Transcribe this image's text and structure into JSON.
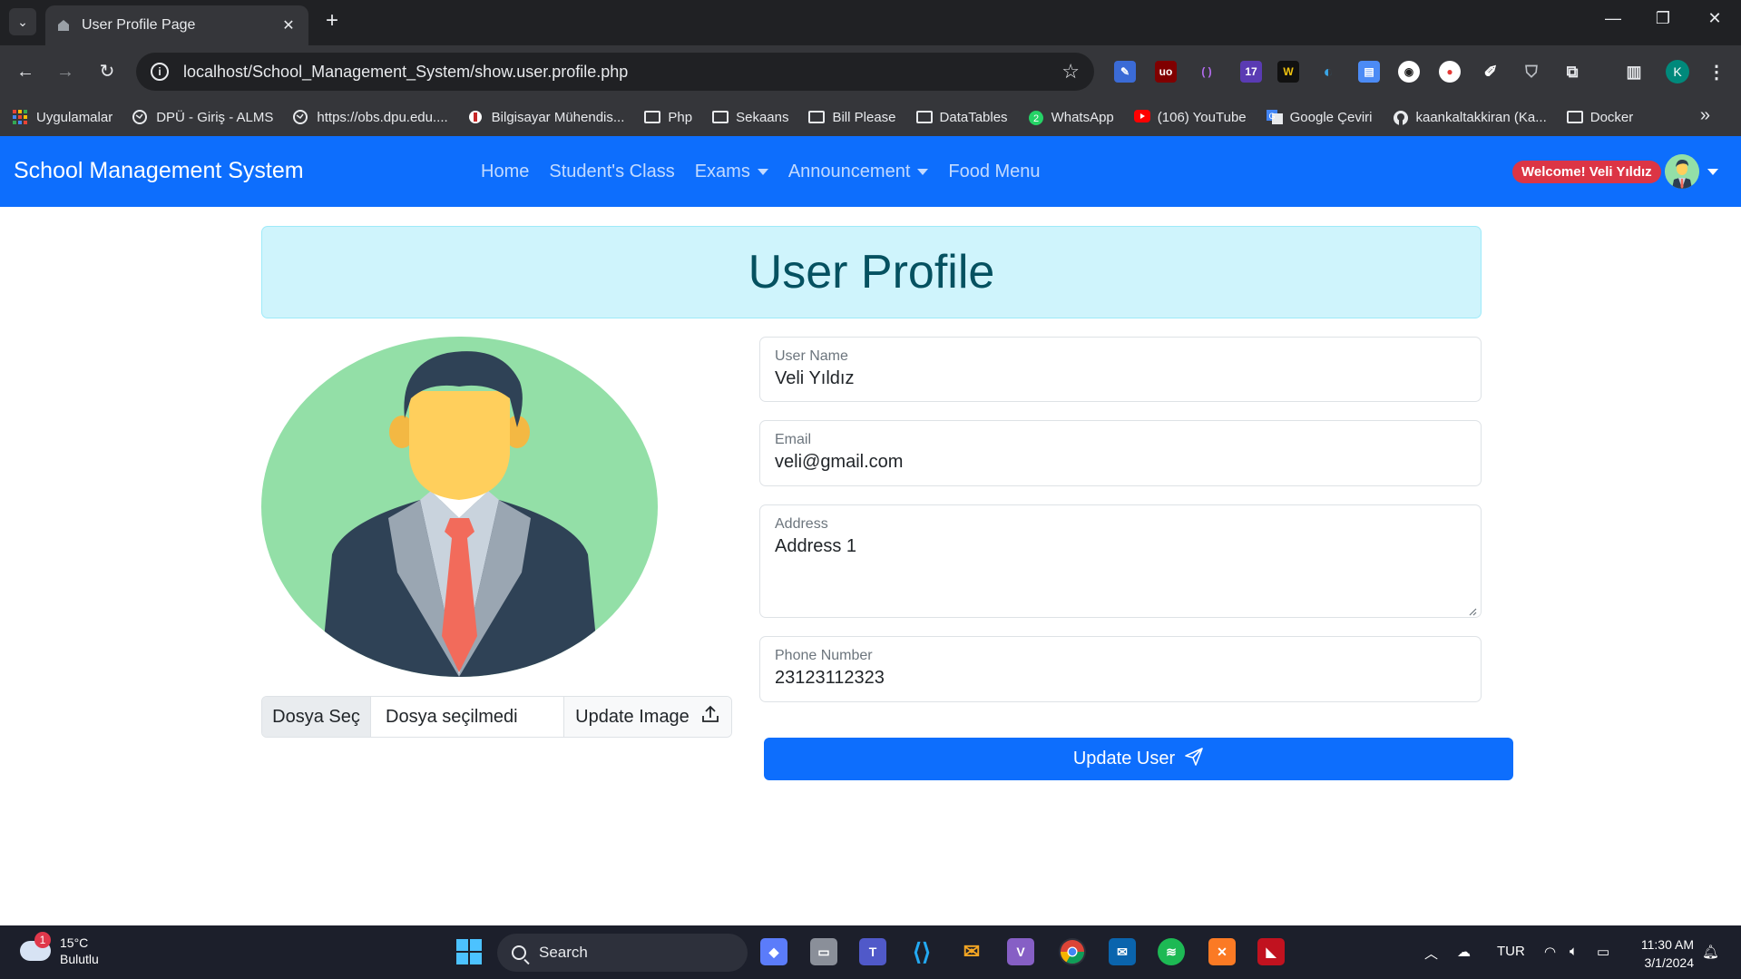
{
  "browser": {
    "tab_title": "User Profile Page",
    "url": "localhost/School_Management_System/show.user.profile.php",
    "bookmarks": [
      {
        "label": "Uygulamalar",
        "icon": "apps-grid-icon"
      },
      {
        "label": "DPÜ - Giriş - ALMS",
        "icon": "globe-icon"
      },
      {
        "label": "https://obs.dpu.edu....",
        "icon": "globe-icon"
      },
      {
        "label": "Bilgisayar Mühendis...",
        "icon": "university-icon"
      },
      {
        "label": "Php",
        "icon": "folder-icon"
      },
      {
        "label": "Sekaans",
        "icon": "folder-icon"
      },
      {
        "label": "Bill Please",
        "icon": "folder-icon"
      },
      {
        "label": "DataTables",
        "icon": "folder-icon"
      },
      {
        "label": "WhatsApp",
        "icon": "whatsapp-icon"
      },
      {
        "label": "(106) YouTube",
        "icon": "youtube-icon"
      },
      {
        "label": "Google Çeviri",
        "icon": "google-translate-icon"
      },
      {
        "label": "kaankaltakkiran (Ka...",
        "icon": "github-icon"
      },
      {
        "label": "Docker",
        "icon": "folder-icon"
      }
    ],
    "extension_badge": "17",
    "profile_initial": "K"
  },
  "navbar": {
    "brand": "School Management System",
    "links": [
      {
        "label": "Home",
        "dropdown": false
      },
      {
        "label": "Student's Class",
        "dropdown": false
      },
      {
        "label": "Exams",
        "dropdown": true
      },
      {
        "label": "Announcement",
        "dropdown": true
      },
      {
        "label": "Food Menu",
        "dropdown": false
      }
    ],
    "welcome": "Welcome! Veli Yıldız"
  },
  "page": {
    "title": "User Profile",
    "file_input": {
      "choose_label": "Dosya Seç",
      "no_file_label": "Dosya seçilmedi",
      "update_image_label": "Update Image"
    },
    "fields": [
      {
        "label": "User Name",
        "value": "Veli Yıldız"
      },
      {
        "label": "Email",
        "value": "veli@gmail.com"
      },
      {
        "label": "Address",
        "value": "Address 1"
      },
      {
        "label": "Phone Number",
        "value": "23123112323"
      }
    ],
    "update_user_label": "Update User"
  },
  "taskbar": {
    "weather_temp": "15°C",
    "weather_desc": "Bulutlu",
    "weather_badge": "1",
    "search_placeholder": "Search",
    "language": "TUR",
    "time": "11:30 AM",
    "date": "3/1/2024"
  },
  "colors": {
    "primary": "#0d6efd",
    "banner_bg": "#cff4fc",
    "banner_text": "#055160",
    "welcome_badge": "#dc3545"
  }
}
